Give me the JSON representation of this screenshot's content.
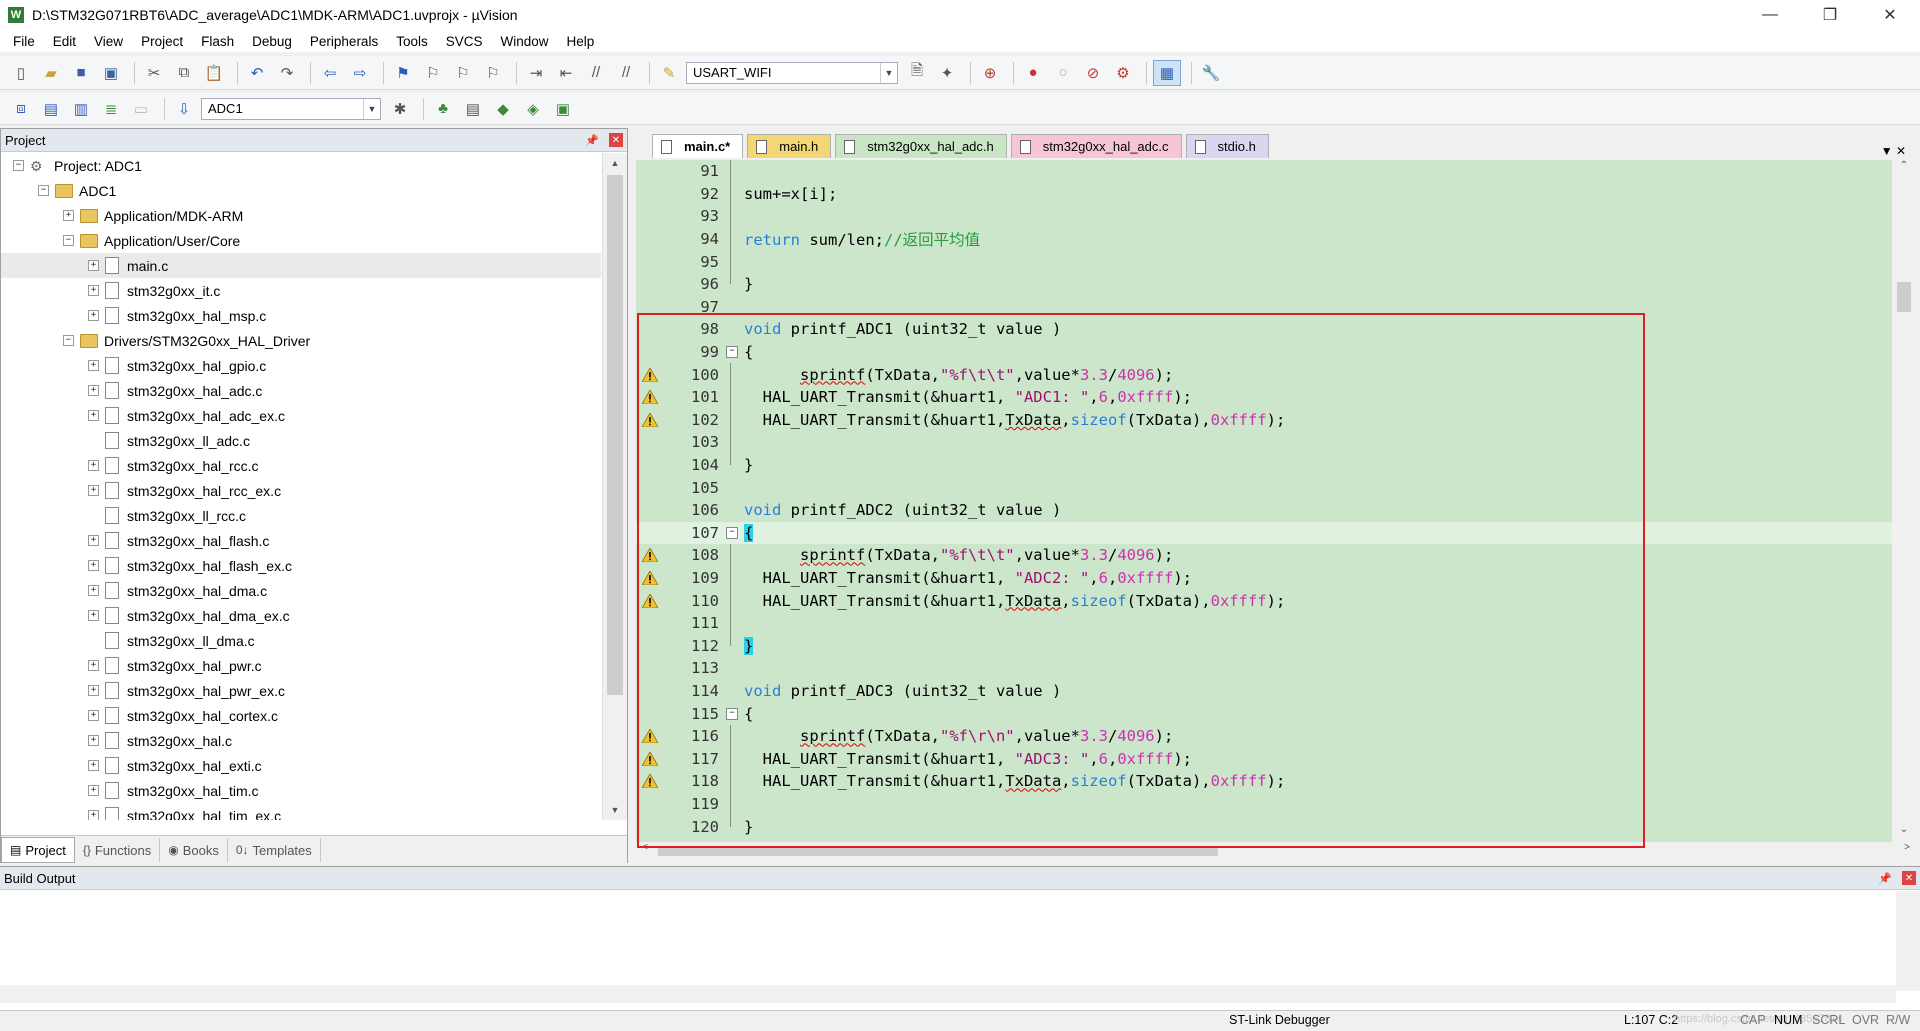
{
  "window": {
    "title": "D:\\STM32G071RBT6\\ADC_average\\ADC1\\MDK-ARM\\ADC1.uvprojx - µVision",
    "app_icon": "W",
    "controls": [
      "—",
      "❐",
      "✕"
    ]
  },
  "menu": [
    "File",
    "Edit",
    "View",
    "Project",
    "Flash",
    "Debug",
    "Peripherals",
    "Tools",
    "SVCS",
    "Window",
    "Help"
  ],
  "toolbar1": {
    "icons": [
      "new-file-icon",
      "open-file-icon",
      "save-icon",
      "save-all-icon",
      "cut-icon",
      "copy-icon",
      "paste-icon",
      "undo-icon",
      "redo-icon",
      "navigate-back-icon",
      "navigate-forward-icon",
      "bookmark-icon",
      "prev-bookmark-icon",
      "next-bookmark-icon",
      "clear-bookmarks-icon",
      "indent-icon",
      "unindent-icon",
      "comment-icon",
      "uncomment-icon"
    ],
    "find_combo_value": "USART_WIFI",
    "icons_after": [
      "find-in-files-icon",
      "incremental-find-icon",
      "debug-session-icon",
      "breakpoint-icon",
      "disable-breakpoint-icon",
      "kill-breakpoints-icon",
      "configure-icon",
      "window-layout-icon",
      "wrench-icon"
    ]
  },
  "toolbar2": {
    "icons": [
      "translate-icon",
      "build-icon",
      "rebuild-icon",
      "batch-build-icon",
      "stop-build-icon",
      "download-icon"
    ],
    "target_combo_value": "ADC1",
    "icons_after": [
      "target-options-icon",
      "manage-components-icon",
      "file-extensions-icon",
      "select-packs-icon",
      "pack-installer-icon"
    ]
  },
  "project_panel": {
    "title": "Project",
    "tree": [
      {
        "level": 0,
        "expander": "⊟",
        "icon": "project",
        "label": "Project: ADC1"
      },
      {
        "level": 1,
        "expander": "⊟",
        "icon": "folder",
        "label": "ADC1"
      },
      {
        "level": 2,
        "expander": "⊞",
        "icon": "folder",
        "label": "Application/MDK-ARM"
      },
      {
        "level": 2,
        "expander": "⊟",
        "icon": "folder",
        "label": "Application/User/Core"
      },
      {
        "level": 3,
        "expander": "⊞",
        "icon": "file",
        "label": "main.c",
        "selected": true
      },
      {
        "level": 3,
        "expander": "⊞",
        "icon": "file",
        "label": "stm32g0xx_it.c"
      },
      {
        "level": 3,
        "expander": "⊞",
        "icon": "file",
        "label": "stm32g0xx_hal_msp.c"
      },
      {
        "level": 2,
        "expander": "⊟",
        "icon": "folder",
        "label": "Drivers/STM32G0xx_HAL_Driver"
      },
      {
        "level": 3,
        "expander": "⊞",
        "icon": "file",
        "label": "stm32g0xx_hal_gpio.c"
      },
      {
        "level": 3,
        "expander": "⊞",
        "icon": "file",
        "label": "stm32g0xx_hal_adc.c"
      },
      {
        "level": 3,
        "expander": "⊞",
        "icon": "file",
        "label": "stm32g0xx_hal_adc_ex.c"
      },
      {
        "level": 3,
        "expander": "",
        "icon": "file",
        "label": "stm32g0xx_ll_adc.c"
      },
      {
        "level": 3,
        "expander": "⊞",
        "icon": "file",
        "label": "stm32g0xx_hal_rcc.c"
      },
      {
        "level": 3,
        "expander": "⊞",
        "icon": "file",
        "label": "stm32g0xx_hal_rcc_ex.c"
      },
      {
        "level": 3,
        "expander": "",
        "icon": "file",
        "label": "stm32g0xx_ll_rcc.c"
      },
      {
        "level": 3,
        "expander": "⊞",
        "icon": "file",
        "label": "stm32g0xx_hal_flash.c"
      },
      {
        "level": 3,
        "expander": "⊞",
        "icon": "file",
        "label": "stm32g0xx_hal_flash_ex.c"
      },
      {
        "level": 3,
        "expander": "⊞",
        "icon": "file",
        "label": "stm32g0xx_hal_dma.c"
      },
      {
        "level": 3,
        "expander": "⊞",
        "icon": "file",
        "label": "stm32g0xx_hal_dma_ex.c"
      },
      {
        "level": 3,
        "expander": "",
        "icon": "file",
        "label": "stm32g0xx_ll_dma.c"
      },
      {
        "level": 3,
        "expander": "⊞",
        "icon": "file",
        "label": "stm32g0xx_hal_pwr.c"
      },
      {
        "level": 3,
        "expander": "⊞",
        "icon": "file",
        "label": "stm32g0xx_hal_pwr_ex.c"
      },
      {
        "level": 3,
        "expander": "⊞",
        "icon": "file",
        "label": "stm32g0xx_hal_cortex.c"
      },
      {
        "level": 3,
        "expander": "⊞",
        "icon": "file",
        "label": "stm32g0xx_hal.c"
      },
      {
        "level": 3,
        "expander": "⊞",
        "icon": "file",
        "label": "stm32g0xx_hal_exti.c"
      },
      {
        "level": 3,
        "expander": "⊞",
        "icon": "file",
        "label": "stm32g0xx_hal_tim.c"
      },
      {
        "level": 3,
        "expander": "⊞",
        "icon": "file",
        "label": "stm32g0xx_hal_tim_ex.c"
      }
    ],
    "tabs": [
      {
        "icon": "project-tab-icon",
        "glyph": "▤",
        "label": "Project",
        "active": true
      },
      {
        "icon": "functions-tab-icon",
        "glyph": "{}",
        "label": "Functions"
      },
      {
        "icon": "books-tab-icon",
        "glyph": "◉",
        "label": "Books"
      },
      {
        "icon": "templates-tab-icon",
        "glyph": "0↓",
        "label": "Templates"
      }
    ]
  },
  "editor": {
    "tabs": [
      {
        "label": "main.c*",
        "active": true
      },
      {
        "label": "main.h"
      },
      {
        "label": "stm32g0xx_hal_adc.h"
      },
      {
        "label": "stm32g0xx_hal_adc.c"
      },
      {
        "label": "stdio.h"
      }
    ],
    "lines": [
      {
        "n": "91",
        "segs": []
      },
      {
        "n": "92",
        "segs": [
          [
            "",
            "sum+=x[i];"
          ]
        ]
      },
      {
        "n": "93",
        "segs": []
      },
      {
        "n": "94",
        "segs": [
          [
            "kw",
            "return"
          ],
          [
            "",
            " sum/len;"
          ],
          [
            "cm",
            "//返回平均值"
          ]
        ]
      },
      {
        "n": "95",
        "segs": []
      },
      {
        "n": "96",
        "segs": [
          [
            "",
            "}"
          ]
        ]
      },
      {
        "n": "97",
        "segs": []
      },
      {
        "n": "98",
        "segs": [
          [
            "kw",
            "void"
          ],
          [
            "",
            " printf_ADC1 (uint32_t value )"
          ]
        ]
      },
      {
        "n": "99",
        "fold": "⊟",
        "segs": [
          [
            "",
            "{"
          ]
        ]
      },
      {
        "n": "100",
        "warn": true,
        "segs": [
          [
            "",
            "      "
          ],
          [
            "squig",
            "sprintf"
          ],
          [
            "",
            "(TxData,"
          ],
          [
            "str",
            "\"%f\\t\\t\""
          ],
          [
            "",
            ",value*"
          ],
          [
            "num",
            "3.3"
          ],
          [
            "",
            "/"
          ],
          [
            "num",
            "4096"
          ],
          [
            "",
            ");"
          ]
        ]
      },
      {
        "n": "101",
        "warn": true,
        "segs": [
          [
            "",
            "  HAL_UART_Transmit(&huart1, "
          ],
          [
            "str",
            "\"ADC1: \""
          ],
          [
            "",
            ","
          ],
          [
            "num",
            "6"
          ],
          [
            "",
            ","
          ],
          [
            "num",
            "0xffff"
          ],
          [
            "",
            ");"
          ]
        ]
      },
      {
        "n": "102",
        "warn": true,
        "segs": [
          [
            "",
            "  HAL_UART_Transmit(&huart1,"
          ],
          [
            "squig",
            "TxData"
          ],
          [
            "",
            ","
          ],
          [
            "kw",
            "sizeof"
          ],
          [
            "",
            "(TxData),"
          ],
          [
            "num",
            "0xffff"
          ],
          [
            "",
            ");"
          ]
        ]
      },
      {
        "n": "103",
        "segs": []
      },
      {
        "n": "104",
        "segs": [
          [
            "",
            "}"
          ]
        ]
      },
      {
        "n": "105",
        "segs": []
      },
      {
        "n": "106",
        "segs": [
          [
            "kw",
            "void"
          ],
          [
            "",
            " printf_ADC2 (uint32_t value )"
          ]
        ]
      },
      {
        "n": "107",
        "fold": "⊟",
        "current": true,
        "segs": [
          [
            "brace",
            "{"
          ]
        ]
      },
      {
        "n": "108",
        "warn": true,
        "segs": [
          [
            "",
            "      "
          ],
          [
            "squig",
            "sprintf"
          ],
          [
            "",
            "(TxData,"
          ],
          [
            "str",
            "\"%f\\t\\t\""
          ],
          [
            "",
            ",value*"
          ],
          [
            "num",
            "3.3"
          ],
          [
            "",
            "/"
          ],
          [
            "num",
            "4096"
          ],
          [
            "",
            ");"
          ]
        ]
      },
      {
        "n": "109",
        "warn": true,
        "segs": [
          [
            "",
            "  HAL_UART_Transmit(&huart1, "
          ],
          [
            "str",
            "\"ADC2: \""
          ],
          [
            "",
            ","
          ],
          [
            "num",
            "6"
          ],
          [
            "",
            ","
          ],
          [
            "num",
            "0xffff"
          ],
          [
            "",
            ");"
          ]
        ]
      },
      {
        "n": "110",
        "warn": true,
        "segs": [
          [
            "",
            "  HAL_UART_Transmit(&huart1,"
          ],
          [
            "squig",
            "TxData"
          ],
          [
            "",
            ","
          ],
          [
            "kw",
            "sizeof"
          ],
          [
            "",
            "(TxData),"
          ],
          [
            "num",
            "0xffff"
          ],
          [
            "",
            ");"
          ]
        ]
      },
      {
        "n": "111",
        "segs": []
      },
      {
        "n": "112",
        "segs": [
          [
            "brace",
            "}"
          ]
        ]
      },
      {
        "n": "113",
        "segs": []
      },
      {
        "n": "114",
        "segs": [
          [
            "kw",
            "void"
          ],
          [
            "",
            " printf_ADC3 (uint32_t value )"
          ]
        ]
      },
      {
        "n": "115",
        "fold": "⊟",
        "segs": [
          [
            "",
            "{"
          ]
        ]
      },
      {
        "n": "116",
        "warn": true,
        "segs": [
          [
            "",
            "      "
          ],
          [
            "squig",
            "sprintf"
          ],
          [
            "",
            "(TxData,"
          ],
          [
            "str",
            "\"%f\\r\\n\""
          ],
          [
            "",
            ",value*"
          ],
          [
            "num",
            "3.3"
          ],
          [
            "",
            "/"
          ],
          [
            "num",
            "4096"
          ],
          [
            "",
            ");"
          ]
        ]
      },
      {
        "n": "117",
        "warn": true,
        "segs": [
          [
            "",
            "  HAL_UART_Transmit(&huart1, "
          ],
          [
            "str",
            "\"ADC3: \""
          ],
          [
            "",
            ","
          ],
          [
            "num",
            "6"
          ],
          [
            "",
            ","
          ],
          [
            "num",
            "0xffff"
          ],
          [
            "",
            ");"
          ]
        ]
      },
      {
        "n": "118",
        "warn": true,
        "segs": [
          [
            "",
            "  HAL_UART_Transmit(&huart1,"
          ],
          [
            "squig",
            "TxData"
          ],
          [
            "",
            ","
          ],
          [
            "kw",
            "sizeof"
          ],
          [
            "",
            "(TxData),"
          ],
          [
            "num",
            "0xffff"
          ],
          [
            "",
            ");"
          ]
        ]
      },
      {
        "n": "119",
        "segs": []
      },
      {
        "n": "120",
        "segs": [
          [
            "",
            "}"
          ]
        ]
      }
    ]
  },
  "build_output": {
    "title": "Build Output"
  },
  "statusbar": {
    "debugger": "ST-Link Debugger",
    "position": "L:107 C:2",
    "watermark": "https://blog.csdn.net/qq_43567814",
    "flags": [
      "CAP",
      "NUM",
      "SCRL",
      "OVR",
      "R/W"
    ]
  },
  "colors": {
    "editor_background": "#cce6cc",
    "keyword": "#2a7fd4",
    "comment": "#2a9a3b",
    "number": "#d02fb0",
    "highlight_box": "#e02020"
  }
}
